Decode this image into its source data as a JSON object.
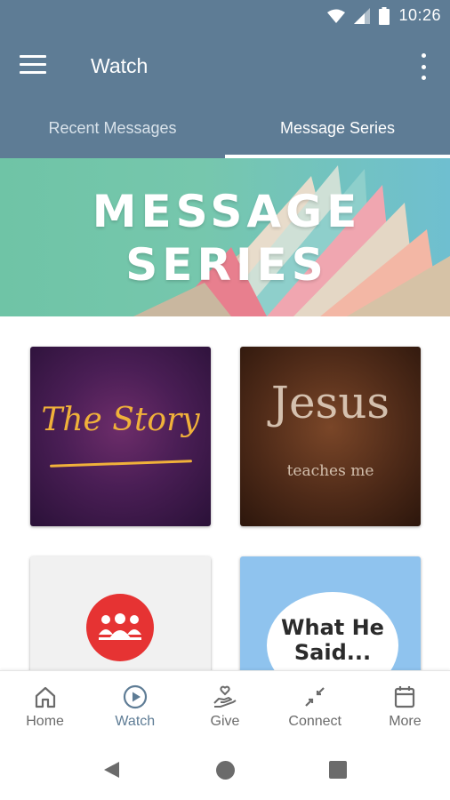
{
  "status_bar": {
    "time": "10:26"
  },
  "app_bar": {
    "title": "Watch"
  },
  "tabs": [
    {
      "label": "Recent Messages",
      "active": false
    },
    {
      "label": "Message Series",
      "active": true
    }
  ],
  "banner": {
    "line1": "MESSAGE",
    "line2": "SERIES"
  },
  "series": [
    {
      "title": "The Story"
    },
    {
      "title": "Jesus",
      "subtitle": "teaches me"
    },
    {
      "title": ""
    },
    {
      "title": "What He Said..."
    }
  ],
  "bottom_nav": [
    {
      "label": "Home",
      "icon": "home-icon",
      "active": false
    },
    {
      "label": "Watch",
      "icon": "play-circle-icon",
      "active": true
    },
    {
      "label": "Give",
      "icon": "hand-heart-icon",
      "active": false
    },
    {
      "label": "Connect",
      "icon": "arrows-in-icon",
      "active": false
    },
    {
      "label": "More",
      "icon": "calendar-icon",
      "active": false
    }
  ],
  "colors": {
    "primary": "#5e7c95",
    "inactive": "#6b6b6b",
    "story_gold": "#f0b13a",
    "group_red": "#e63333"
  }
}
